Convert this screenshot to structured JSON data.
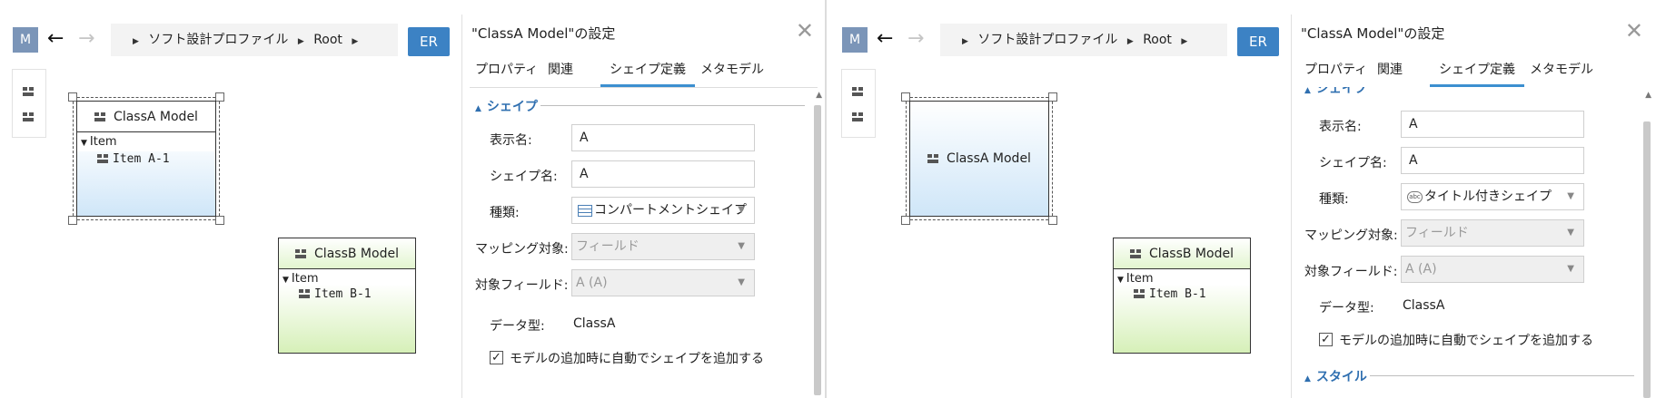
{
  "left": {
    "canvas": {
      "menu_button": "M",
      "breadcrumb": [
        "ソフト設計プロファイル",
        "Root"
      ],
      "er_button": "ER",
      "classA": {
        "title": "ClassA Model",
        "compartment": "Item",
        "item": "Item A-1"
      },
      "classB": {
        "title": "ClassB Model",
        "compartment": "Item",
        "item": "Item B-1"
      }
    },
    "panel": {
      "title": "\"ClassA Model\"の設定",
      "tabs": [
        "プロパティ",
        "関連",
        "シェイプ定義",
        "メタモデル"
      ],
      "active_tab": "シェイプ定義",
      "section_shape": "シェイプ",
      "display_name_label": "表示名:",
      "display_name_value": "A",
      "shape_name_label": "シェイプ名:",
      "shape_name_value": "A",
      "kind_label": "種類:",
      "kind_value": "コンパートメントシェイプ",
      "mapping_label": "マッピング対象:",
      "mapping_value": "フィールド",
      "target_field_label": "対象フィールド:",
      "target_field_value": "A (A)",
      "data_type_label": "データ型:",
      "data_type_value": "ClassA",
      "auto_add_label": "モデルの追加時に自動でシェイプを追加する",
      "auto_add_checked": true
    }
  },
  "right": {
    "canvas": {
      "menu_button": "M",
      "breadcrumb": [
        "ソフト設計プロファイル",
        "Root"
      ],
      "er_button": "ER",
      "classA": {
        "title": "ClassA Model"
      },
      "classB": {
        "title": "ClassB Model",
        "compartment": "Item",
        "item": "Item B-1"
      }
    },
    "panel": {
      "title": "\"ClassA Model\"の設定",
      "tabs": [
        "プロパティ",
        "関連",
        "シェイプ定義",
        "メタモデル"
      ],
      "active_tab": "シェイプ定義",
      "section_shape_partial": "シェイプ",
      "display_name_label": "表示名:",
      "display_name_value": "A",
      "shape_name_label": "シェイプ名:",
      "shape_name_value": "A",
      "kind_label": "種類:",
      "kind_icon_text": "abc",
      "kind_value": "タイトル付きシェイプ",
      "mapping_label": "マッピング対象:",
      "mapping_value": "フィールド",
      "target_field_label": "対象フィールド:",
      "target_field_value": "A (A)",
      "data_type_label": "データ型:",
      "data_type_value": "ClassA",
      "auto_add_label": "モデルの追加時に自動でシェイプを追加する",
      "auto_add_checked": true,
      "section_style": "スタイル"
    }
  },
  "colors": {
    "accent": "#3c82c4",
    "menu_button": "#7b95b8",
    "classA_gradient_bottom": "#cfe6f8",
    "classB_gradient_bottom": "#d6f0b8",
    "section_text": "#2f6fb0"
  },
  "icons": [
    "back-arrow-icon",
    "forward-arrow-icon",
    "breadcrumb-caret-icon",
    "class-shape-icon",
    "close-icon",
    "dropdown-arrow-icon",
    "checkbox-icon",
    "compartment-shape-icon",
    "titled-shape-icon"
  ]
}
